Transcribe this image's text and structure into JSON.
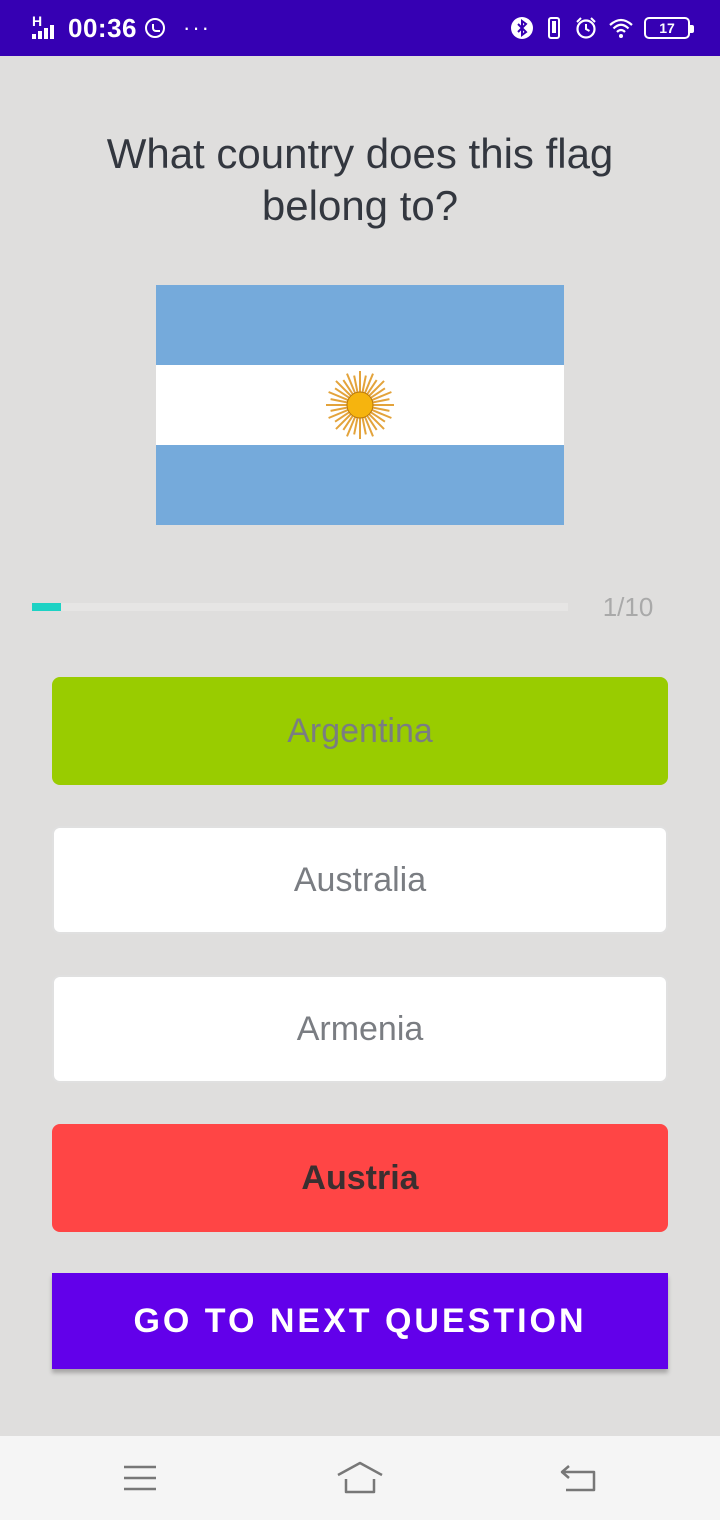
{
  "status_bar": {
    "network": "H",
    "time": "00:36",
    "battery": "17",
    "icons": [
      "signal-icon",
      "whatsapp-icon",
      "more-icon",
      "bluetooth-icon",
      "vibrate-icon",
      "alarm-icon",
      "wifi-icon",
      "battery-icon"
    ],
    "background": "#3600b3"
  },
  "quiz": {
    "question": "What country does this flag belong to?",
    "flag": "argentina-flag",
    "progress": {
      "text": "1/10",
      "fraction": 0.1,
      "color": "#1dd2c4"
    },
    "answers": [
      {
        "label": "Argentina",
        "state": "correct",
        "color": "#99cc00"
      },
      {
        "label": "Australia",
        "state": "neutral",
        "color": "#ffffff"
      },
      {
        "label": "Armenia",
        "state": "neutral",
        "color": "#ffffff"
      },
      {
        "label": "Austria",
        "state": "wrong",
        "color": "#ff4545"
      }
    ],
    "next_button": {
      "label": "GO TO NEXT QUESTION",
      "color": "#6200ea"
    }
  },
  "nav_bar": {
    "icons": [
      "menu-icon",
      "home-icon",
      "back-icon"
    ]
  }
}
